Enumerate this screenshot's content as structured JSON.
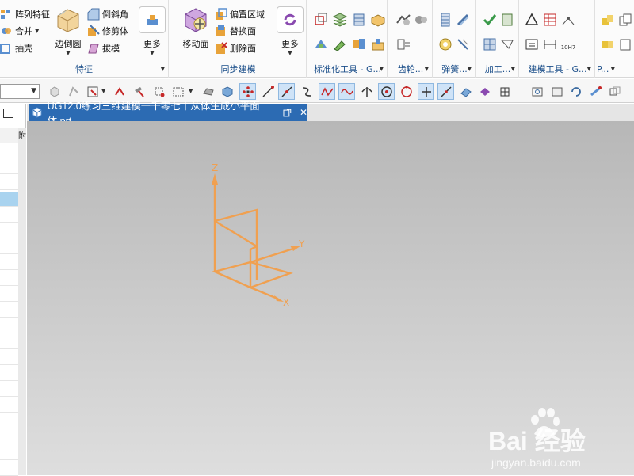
{
  "ribbon": {
    "feature_group": {
      "label": "特征",
      "pattern_feature": "阵列特征",
      "combine": "合并",
      "shell": "抽壳",
      "edge_blend": "边倒圆",
      "chamfer": "倒斜角",
      "trim_body": "修剪体",
      "draft": "拔模",
      "more": "更多"
    },
    "sync_group": {
      "label": "同步建模",
      "move_face": "移动面",
      "offset_region": "偏置区域",
      "replace_face": "替换面",
      "delete_face": "删除面",
      "more": "更多"
    },
    "std_tools_group": {
      "label": "标准化工具 - G..."
    },
    "gear_group": {
      "label": "齿轮..."
    },
    "spring_group": {
      "label": "弹簧..."
    },
    "machining_group": {
      "label": "加工..."
    },
    "modeling_tools_group": {
      "label": "建模工具 - G..."
    },
    "extra_group": {
      "label": "P..."
    },
    "tolerance_icon_text": "10H7"
  },
  "tab": {
    "title": "UG12.0练习三维建模一千零七十从体生成小平面体.prt",
    "close": "✕"
  },
  "navigator": {
    "column_header": "附"
  },
  "viewport": {
    "axis_x": "X",
    "axis_y": "Y",
    "axis_z": "Z",
    "axis_color": "#f0a050"
  },
  "watermark": {
    "brand": "Bai 经验",
    "site": "jingyan.baidu.com"
  },
  "colors": {
    "tab_active": "#2c6bb3",
    "ribbon_label": "#1c4f8a",
    "model_orange": "#f0a050"
  }
}
